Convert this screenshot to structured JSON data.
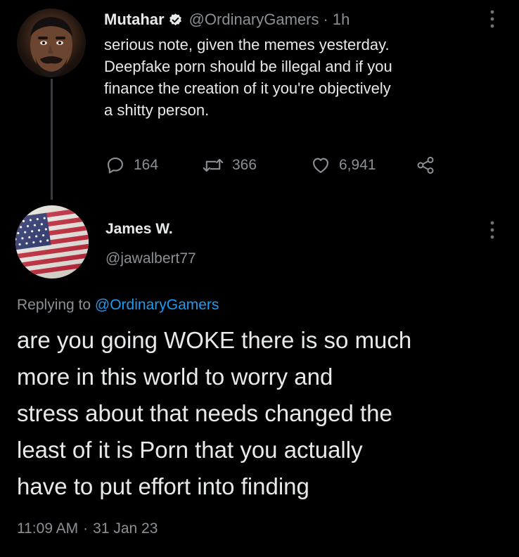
{
  "tweet": {
    "author_name": "Mutahar",
    "author_handle": "@OrdinaryGamers",
    "separator": "·",
    "relative_time": "1h",
    "lines": [
      "serious note, given the memes yesterday.",
      "Deepfake porn should be illegal and if you",
      "finance the creation of it you're objectively",
      "a shitty person."
    ],
    "reply_count": "164",
    "retweet_count": "366",
    "like_count": "6,941"
  },
  "reply": {
    "author_name": "James W.",
    "author_handle": "@jawalbert77",
    "replying_prefix": "Replying to",
    "replying_handle": "@OrdinaryGamers",
    "lines": [
      "are you going WOKE there is so much",
      "more in this world to worry and",
      "stress about that needs changed the",
      "least of it is Porn that you actually",
      "have to put effort into finding"
    ],
    "time": "11:09 AM",
    "separator": "·",
    "date": "31 Jan 23"
  },
  "icons": {
    "verified": "verified-badge-icon",
    "reply": "reply-icon",
    "retweet": "retweet-icon",
    "like": "heart-icon",
    "share": "share-icon",
    "more": "more-vertical-icon"
  },
  "colors": {
    "background": "#000000",
    "text": "#e7e9ea",
    "muted": "#8b9096",
    "accent": "#1d9bf0"
  }
}
